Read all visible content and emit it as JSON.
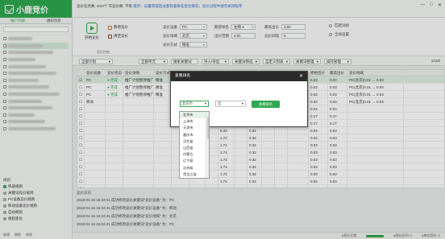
{
  "app": {
    "name": "小鹿竞价",
    "accent": "#2fa84f"
  },
  "sidebar": {
    "tabs": [
      "账户列表",
      "通知消息"
    ],
    "tree_rows": 14,
    "bottom_title": "规则",
    "rules": [
      "快速规则",
      "关键词竞价规则",
      "PC设备竞价规则",
      "移动设备竞价规则",
      "自动规则",
      "规则变化"
    ],
    "actions": [
      "新建",
      "删除",
      "修改"
    ]
  },
  "topbar": {
    "info": "竞价任务数: 0/10个   可竞价数: 不限",
    "notice": "提示：设置完成后注意检查排名变化情况；竞价过程中请勿关闭程序",
    "window_buttons": [
      "—",
      "□",
      "✕"
    ]
  },
  "toolbar": {
    "start_label": "开始竞价",
    "pause_label": "暂停竞价",
    "clear_label": "清空竞价",
    "section_label": "竞价控制",
    "fields": [
      {
        "label": "竞价设备",
        "value": "PC"
      },
      {
        "label": "竞价地域",
        "value": "北京"
      },
      {
        "label": "竞价方式",
        "value": "精准"
      },
      {
        "label": "期望排名",
        "value": "左侧-1"
      },
      {
        "label": "出价范围",
        "value": "0.01"
      },
      {
        "label": "最高出价",
        "value": "3.00"
      },
      {
        "label": "竞价间隔",
        "value": "5"
      }
    ],
    "right_options": [
      "匹配词组",
      "全局设置"
    ]
  },
  "filters": [
    "全部计划",
    "全部单元",
    "搜索关键词",
    "导入/导出",
    "关键词筛选",
    "自定义列表",
    "关键词管理",
    "操作管理"
  ],
  "page_count": "1/102",
  "table": {
    "columns": [
      "",
      "竞价设备",
      "竞价状态",
      "竞价详情",
      "竞价方式",
      "期望排名",
      "竞价间隔",
      "出价",
      "当前排名",
      "最低价",
      "最高价",
      "当前出价",
      "质量度",
      "移动端出价",
      "原始出价",
      "最高出价",
      "竞价地域"
    ],
    "rows": [
      [
        "☑",
        "PC",
        "● 完成",
        "推广计划暂停推广",
        "精准",
        "左侧-1",
        "5",
        "",
        "",
        "",
        "",
        "",
        "",
        "",
        "0.03",
        "0.03",
        "PC(北京)0.01 → 0.03"
      ],
      [
        "☐",
        "PC",
        "● 完成",
        "推广计划暂停推广",
        "精准",
        "左侧-1",
        "5",
        "",
        "",
        "",
        "",
        "",
        "",
        "",
        "0.03",
        "0.03",
        "PC(北京)0.01 → 0.03"
      ],
      [
        "☐",
        "PC",
        "● 完成",
        "推广计划暂停推广",
        "精准",
        "左侧-1",
        "5",
        "",
        "",
        "",
        "",
        "",
        "",
        "",
        "0.03",
        "0.03",
        "PC(北京)0.01 → 0.03"
      ],
      [
        "☐",
        "移动",
        "",
        "",
        "",
        "",
        "",
        "",
        "",
        "",
        "",
        "",
        "",
        "",
        "0.03",
        "0.03",
        "PC(北京)0.01 → 0.03"
      ],
      [
        "☐",
        "",
        "",
        "",
        "",
        "",
        "",
        "",
        "",
        "",
        "",
        "",
        "",
        "",
        "0.03",
        "0.03",
        ""
      ],
      [
        "☐",
        "",
        "",
        "",
        "",
        "",
        "",
        "",
        "1.74",
        "",
        "0.32",
        "",
        "",
        "",
        "0.17",
        "0.17",
        ""
      ],
      [
        "☐",
        "",
        "",
        "",
        "",
        "",
        "",
        "",
        "1.74",
        "",
        "0.32",
        "",
        "",
        "",
        "0.17",
        "0.17",
        ""
      ],
      [
        "☐",
        "",
        "",
        "",
        "",
        "",
        "",
        "",
        "0.44",
        "",
        "0.32",
        "",
        "",
        "",
        "0.03",
        "0.03",
        ""
      ],
      [
        "☐",
        "",
        "",
        "",
        "",
        "",
        "",
        "",
        "1.74",
        "",
        "0.32",
        "",
        "",
        "",
        "0.03",
        "0.03",
        ""
      ],
      [
        "☐",
        "",
        "",
        "",
        "",
        "",
        "",
        "",
        "1.74",
        "",
        "0.32",
        "",
        "",
        "",
        "0.03",
        "0.03",
        ""
      ],
      [
        "☐",
        "",
        "",
        "",
        "",
        "",
        "",
        "",
        "1.74",
        "",
        "0.32",
        "",
        "",
        "",
        "0.03",
        "0.03",
        ""
      ],
      [
        "☐",
        "",
        "",
        "",
        "",
        "",
        "",
        "",
        "1.74",
        "",
        "0.32",
        "",
        "",
        "",
        "0.03",
        "0.03",
        ""
      ],
      [
        "☐",
        "",
        "",
        "",
        "",
        "",
        "",
        "",
        "1.74",
        "",
        "0.32",
        "",
        "",
        "",
        "0.03",
        "0.03",
        ""
      ],
      [
        "☐",
        "",
        "",
        "",
        "",
        "",
        "",
        "",
        "1.74",
        "",
        "0.32",
        "",
        "",
        "",
        "0.03",
        "0.03",
        ""
      ],
      [
        "☐",
        "",
        "",
        "",
        "",
        "",
        "",
        "",
        "1.74",
        "",
        "0.32",
        "",
        "",
        "",
        "0.03",
        "0.03",
        ""
      ],
      [
        "☐",
        "",
        "",
        "",
        "",
        "",
        "",
        "",
        "1.74",
        "",
        "0.32",
        "",
        "",
        "",
        "0.03",
        "0.03",
        ""
      ]
    ]
  },
  "log": {
    "title": "竞价日志",
    "lines": [
      "2018-01-16 15:34:41 成功修改竞价关键词\"竞价设备\" 为：PC",
      "2018-01-16 15:34:41 成功修改竞价关键词\"竞价设备\" 为：移动",
      "2018-01-16 15:34:41 成功修改竞价关键词\"竞价地域\" 为：北京",
      "2018-01-16 15:34:41 成功修改竞价关键词\"竞价设备\" 为：PC"
    ]
  },
  "status": [
    "●竞价正常",
    "●竞价队列: 0",
    "●单次竞价: 0"
  ],
  "dialog": {
    "title": "查看排名",
    "close": "✕",
    "region_value": "北京市",
    "city_value": "无",
    "query_label": "查看排名",
    "region_options": [
      "北京市",
      "上海市",
      "天津市",
      "重庆市",
      "河北省",
      "山西省",
      "内蒙古",
      "辽宁省",
      "吉林省",
      "黑龙江省"
    ]
  }
}
